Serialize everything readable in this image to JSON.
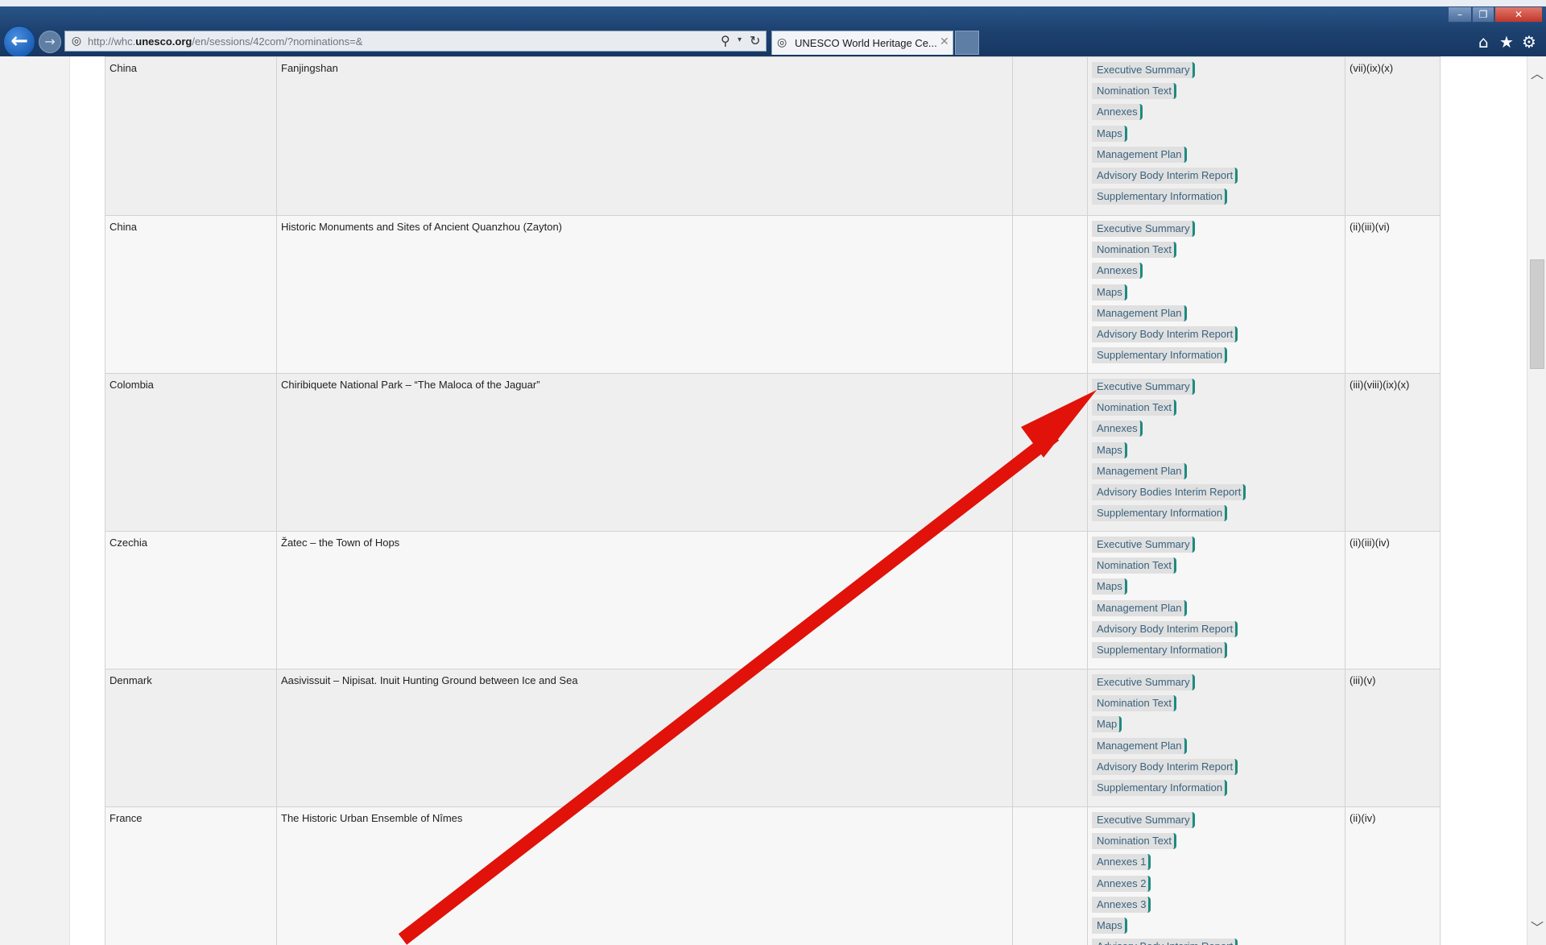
{
  "browser": {
    "url_prefix": "http://whc.",
    "url_domain": "unesco.org",
    "url_suffix": "/en/sessions/42com/?nominations=&",
    "tab_title": "UNESCO World Heritage Ce...",
    "back_glyph": "←",
    "forward_glyph": "→",
    "tab_close_glyph": "✕",
    "search_glyph": "⚲",
    "refresh_glyph": "↻",
    "dropdown_glyph": "▾",
    "min_glyph": "–",
    "max_glyph": "❐",
    "close_glyph": "✕",
    "home_glyph": "⌂",
    "star_glyph": "★",
    "gear_glyph": "⚙"
  },
  "scrollbar": {
    "up_glyph": "︿",
    "down_glyph": "﹀"
  },
  "nominations": [
    {
      "state": "China",
      "property": "Fanjingshan",
      "documents": [
        "Executive Summary",
        "Nomination Text",
        "Annexes",
        "Maps",
        "Management Plan",
        "Advisory Body Interim Report",
        "Supplementary Information"
      ],
      "criteria": "(vii)(ix)(x)"
    },
    {
      "state": "China",
      "property": "Historic Monuments and Sites of Ancient Quanzhou (Zayton)",
      "documents": [
        "Executive Summary",
        "Nomination Text",
        "Annexes",
        "Maps",
        "Management Plan",
        "Advisory Body Interim Report",
        "Supplementary Information"
      ],
      "criteria": "(ii)(iii)(vi)"
    },
    {
      "state": "Colombia",
      "property": "Chiribiquete National Park – “The Maloca of the Jaguar”",
      "documents": [
        "Executive Summary",
        "Nomination Text",
        "Annexes",
        "Maps",
        "Management Plan",
        "Advisory Bodies Interim Report",
        "Supplementary Information"
      ],
      "criteria": "(iii)(viii)(ix)(x)"
    },
    {
      "state": "Czechia",
      "property": "Žatec – the Town of Hops",
      "documents": [
        "Executive Summary",
        "Nomination Text",
        "Maps",
        "Management Plan",
        "Advisory Body Interim Report",
        "Supplementary Information"
      ],
      "criteria": "(ii)(iii)(iv)"
    },
    {
      "state": "Denmark",
      "property": "Aasivissuit – Nipisat. Inuit Hunting Ground between Ice and Sea",
      "documents": [
        "Executive Summary",
        "Nomination Text",
        "Map",
        "Management Plan",
        "Advisory Body Interim Report",
        "Supplementary Information"
      ],
      "criteria": "(iii)(v)"
    },
    {
      "state": "France",
      "property": "The Historic Urban Ensemble of Nîmes",
      "documents": [
        "Executive Summary",
        "Nomination Text",
        "Annexes 1",
        "Annexes 2",
        "Annexes 3",
        "Maps",
        "Advisory Body Interim Report"
      ],
      "criteria": "(ii)(iv)"
    }
  ],
  "annotation": {
    "color": "#e0120a"
  }
}
